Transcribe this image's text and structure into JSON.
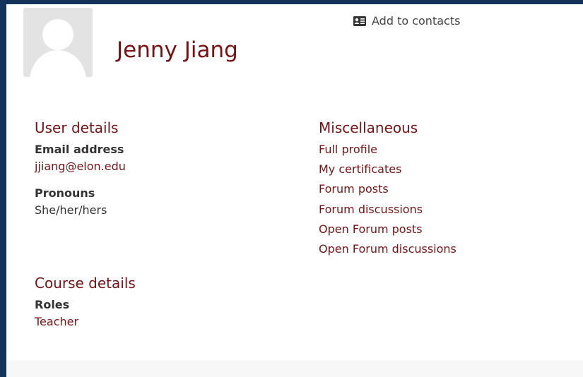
{
  "profile": {
    "name": "Jenny Jiang",
    "add_to_contacts": "Add to contacts",
    "avatar_icon": "user-placeholder-icon",
    "contact_icon": "contact-card-icon"
  },
  "user_details": {
    "title": "User details",
    "email_label": "Email address",
    "email_value": "jjiang@elon.edu",
    "pronouns_label": "Pronouns",
    "pronouns_value": "She/her/hers"
  },
  "course_details": {
    "title": "Course details",
    "roles_label": "Roles",
    "roles_value": "Teacher"
  },
  "miscellaneous": {
    "title": "Miscellaneous",
    "links": [
      "Full profile",
      "My certificates",
      "Forum posts",
      "Forum discussions",
      "Open Forum posts",
      "Open Forum discussions"
    ]
  },
  "colors": {
    "accent": "#7a1214",
    "page_background": "#13335a",
    "text": "#333333"
  }
}
